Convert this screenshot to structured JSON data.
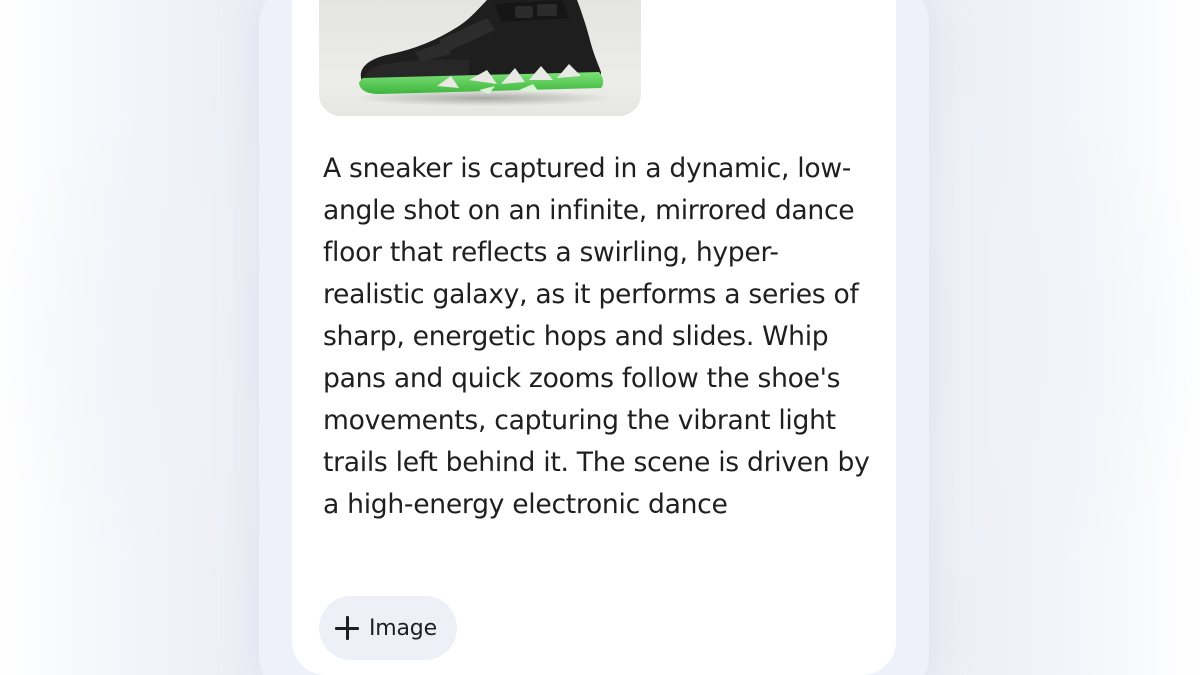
{
  "prompt_card": {
    "thumbnail": {
      "image_icon": "sneaker-image",
      "colors": {
        "upper": "#1c1d1c",
        "sole_accent": "#5fd35a",
        "background": "#e8e8e5"
      }
    },
    "description_lines": [
      "A sneaker is captured in a dynamic, low-",
      "angle shot on an infinite, mirrored dance",
      "floor that reflects a swirling, hyper-",
      "realistic galaxy, as it performs a series of",
      "sharp, energetic hops and slides. Whip",
      "pans and quick zooms follow the shoe's",
      "movements, capturing the vibrant light",
      "trails left behind it. The scene is driven by",
      "a high-energy electronic dance"
    ],
    "add_image_chip": {
      "icon": "plus-icon",
      "label": "Image"
    }
  },
  "colors": {
    "text": "#1f1f1f",
    "card_background": "#ffffff",
    "chip_background": "#eef0f8",
    "page_background": "#eef0f7"
  }
}
